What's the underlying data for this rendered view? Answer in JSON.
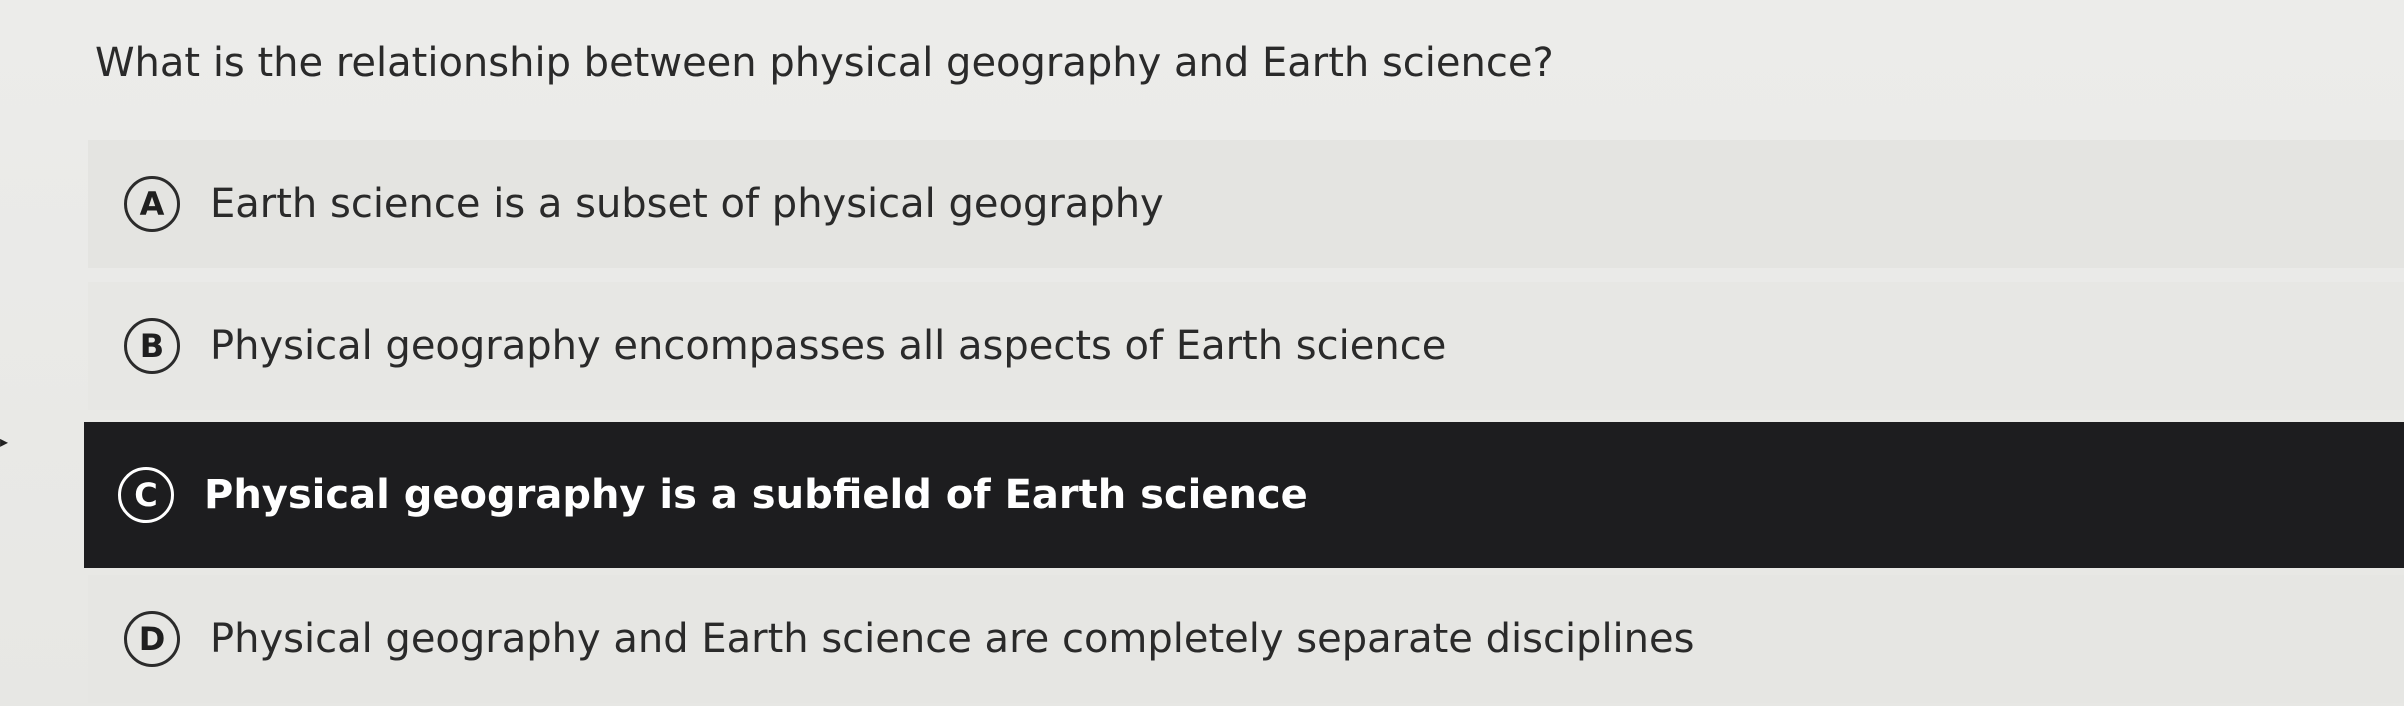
{
  "question": "What is the relationship between physical geography and Earth science?",
  "options": [
    {
      "letter": "A",
      "text": "Earth science is a subset of physical geography",
      "selected": false
    },
    {
      "letter": "B",
      "text": "Physical geography encompasses all aspects of Earth science",
      "selected": false
    },
    {
      "letter": "C",
      "text": "Physical geography is a subfield of Earth science",
      "selected": true
    },
    {
      "letter": "D",
      "text": "Physical geography and Earth science are completely separate disciplines",
      "selected": false
    }
  ],
  "colors": {
    "background": "#e9e9e6",
    "selected_background": "#1d1d1f",
    "selected_text": "#ffffff",
    "text": "#2a2a2a"
  }
}
